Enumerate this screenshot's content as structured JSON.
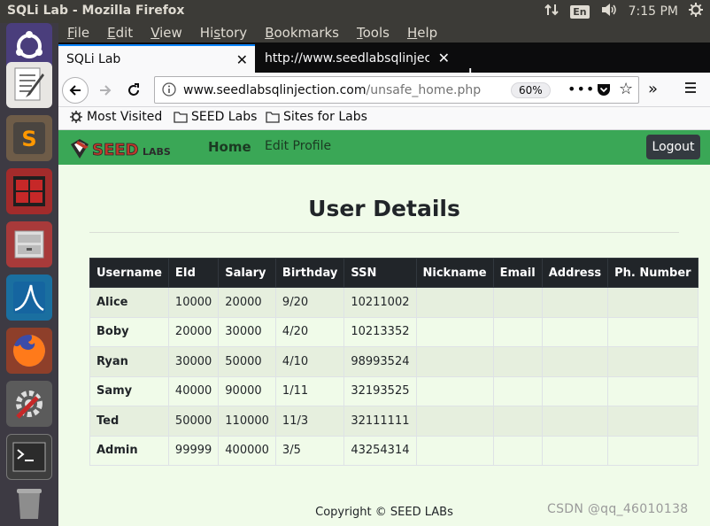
{
  "system_bar": {
    "window_title": "SQLi Lab - Mozilla Firefox",
    "keyboard_layout": "En",
    "clock": "7:15 PM",
    "tray_icons": [
      "network-arrows-icon",
      "keyboard-layout-icon",
      "volume-icon",
      "power-gear-icon"
    ]
  },
  "launcher": {
    "items": [
      "ubuntu-dash",
      "text-editor",
      "sublime-text",
      "terminal-red",
      "file-manager",
      "wireshark",
      "firefox",
      "system-settings",
      "terminal",
      "trash"
    ]
  },
  "menu": {
    "items": [
      {
        "accel": "F",
        "rest": "ile"
      },
      {
        "accel": "E",
        "rest": "dit"
      },
      {
        "accel": "V",
        "rest": "iew"
      },
      {
        "accel": "",
        "rest": "Hi",
        "accel2": "s",
        "rest2": "tory"
      },
      {
        "accel": "B",
        "rest": "ookmarks"
      },
      {
        "accel": "T",
        "rest": "ools"
      },
      {
        "accel": "H",
        "rest": "elp"
      }
    ]
  },
  "tabs": {
    "active": {
      "title": "SQLi Lab"
    },
    "inactive": {
      "title": "http://www.seedlabsqlinjec"
    },
    "close_glyph": "✕",
    "new_tab_glyph": "+"
  },
  "urlbar": {
    "url_host": "www.seedlabsqlinjection.com",
    "url_path": "/unsafe_home.php",
    "zoom": "60%",
    "more_glyph": "•••"
  },
  "bookmarks": {
    "items": [
      "Most Visited",
      "SEED Labs",
      "Sites for Labs"
    ]
  },
  "site": {
    "logo_text_main": "SEED",
    "logo_text_sub": "LABS",
    "nav_home": "Home",
    "nav_edit_profile": "Edit Profile",
    "logout": "Logout",
    "page_title": "User Details",
    "footer": "Copyright © SEED LABs",
    "colors": {
      "navbar": "#3aa756",
      "page_bg": "#f0fbe9",
      "table_header": "#212529",
      "logo_red": "#c0392b"
    }
  },
  "user_table": {
    "headers": [
      "Username",
      "EId",
      "Salary",
      "Birthday",
      "SSN",
      "Nickname",
      "Email",
      "Address",
      "Ph. Number"
    ],
    "rows": [
      [
        "Alice",
        "10000",
        "20000",
        "9/20",
        "10211002",
        "",
        "",
        "",
        ""
      ],
      [
        "Boby",
        "20000",
        "30000",
        "4/20",
        "10213352",
        "",
        "",
        "",
        ""
      ],
      [
        "Ryan",
        "30000",
        "50000",
        "4/10",
        "98993524",
        "",
        "",
        "",
        ""
      ],
      [
        "Samy",
        "40000",
        "90000",
        "1/11",
        "32193525",
        "",
        "",
        "",
        ""
      ],
      [
        "Ted",
        "50000",
        "110000",
        "11/3",
        "32111111",
        "",
        "",
        "",
        ""
      ],
      [
        "Admin",
        "99999",
        "400000",
        "3/5",
        "43254314",
        "",
        "",
        "",
        ""
      ]
    ]
  },
  "watermark": "CSDN @qq_46010138"
}
